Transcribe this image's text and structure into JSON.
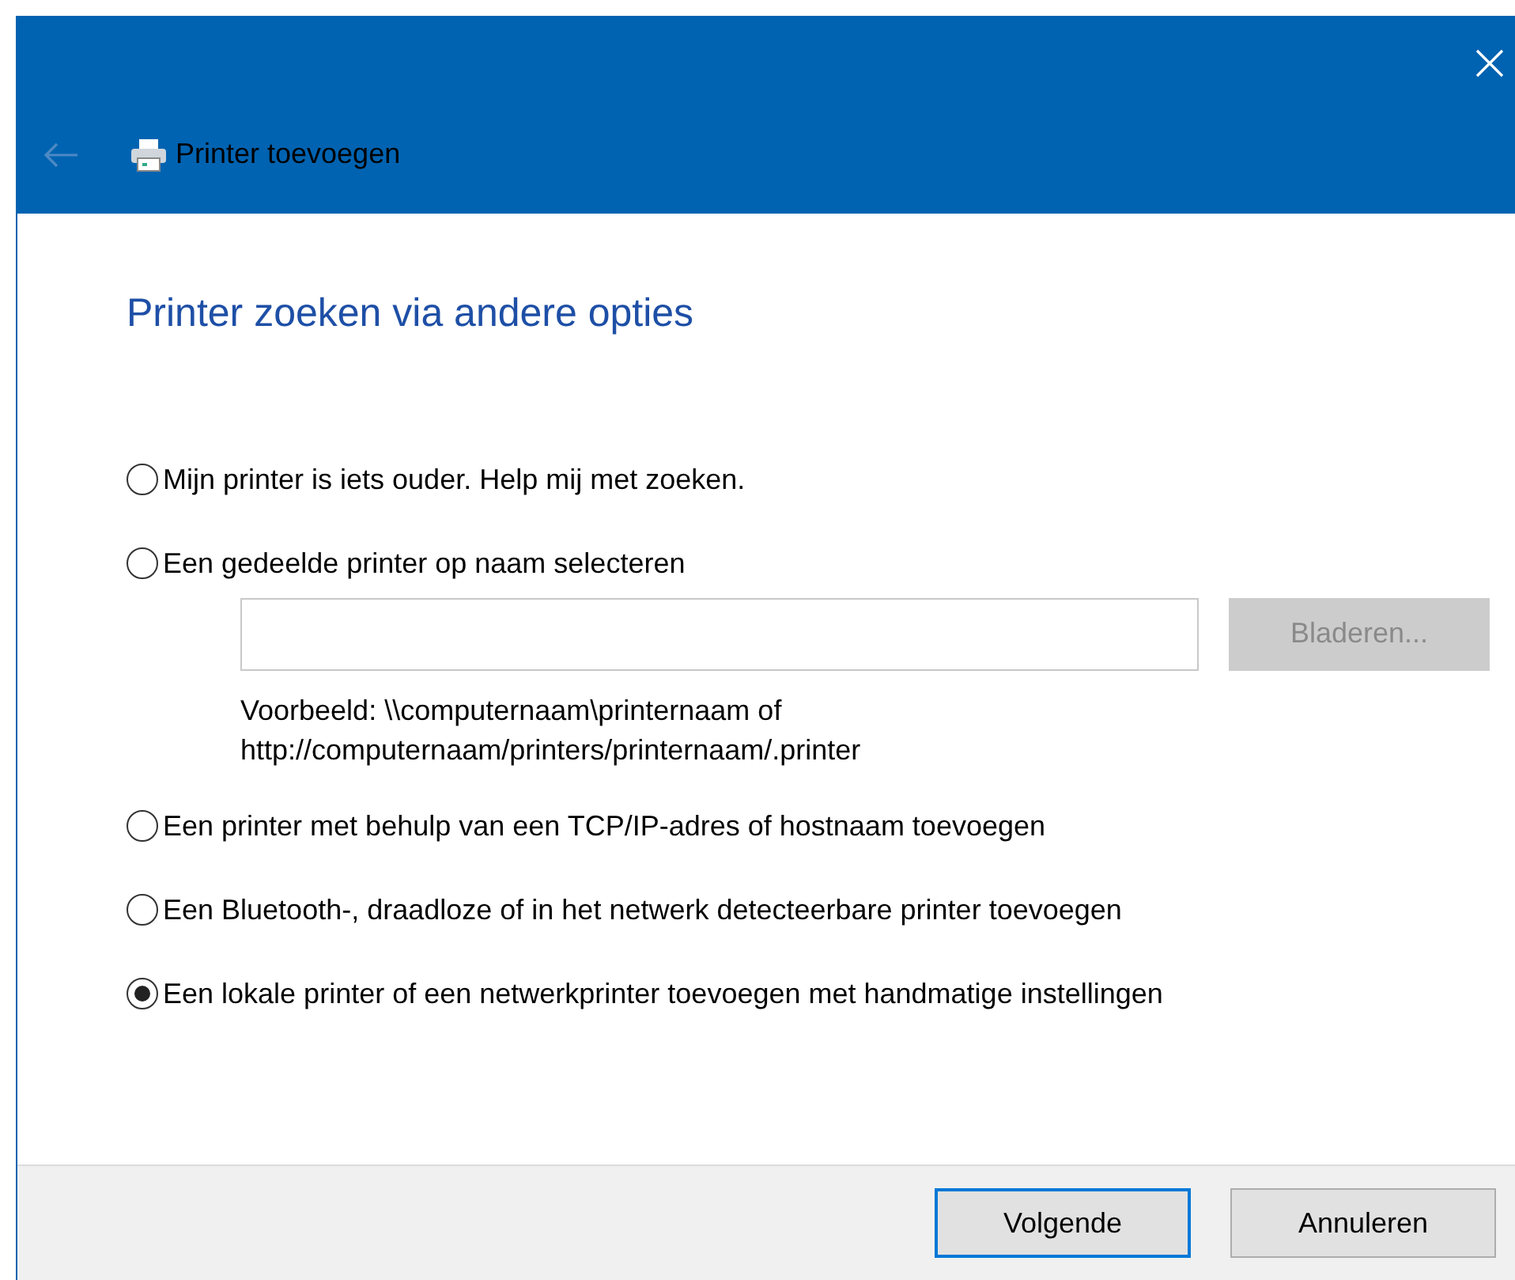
{
  "window": {
    "title": "Printer toevoegen",
    "back_disabled": true
  },
  "heading": "Printer zoeken via andere opties",
  "options": [
    {
      "label": "Mijn printer is iets ouder. Help mij met zoeken.",
      "selected": false
    },
    {
      "label": "Een gedeelde printer op naam selecteren",
      "selected": false,
      "browse_button": {
        "label": "Bladeren...",
        "disabled": true
      },
      "example": [
        "Voorbeeld: \\\\computernaam\\printernaam of",
        "http://computernaam/printers/printernaam/.printer"
      ]
    },
    {
      "label": "Een printer met behulp van een TCP/IP-adres of hostnaam toevoegen",
      "selected": false
    },
    {
      "label": "Een Bluetooth-, draadloze of in het netwerk detecteerbare printer toevoegen",
      "selected": false
    },
    {
      "label": "Een lokale printer of een netwerkprinter toevoegen met handmatige instellingen",
      "selected": true
    }
  ],
  "buttons": [
    {
      "label": "Volgende",
      "default": true
    },
    {
      "label": "Annuleren",
      "default": false
    }
  ]
}
